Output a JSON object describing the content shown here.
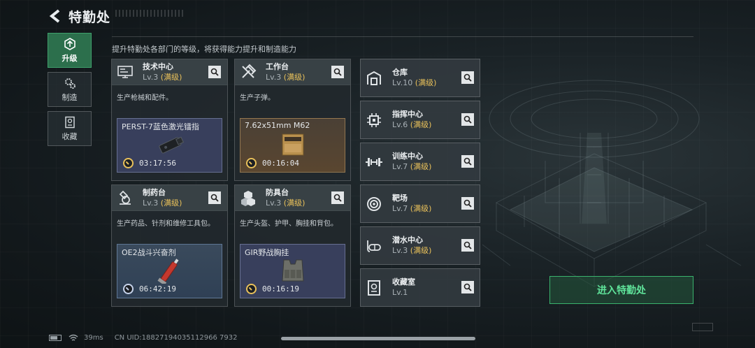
{
  "header": {
    "title": "特勤处"
  },
  "subtitle": "提升特勤处各部门的等级，将获得能力提升和制造能力",
  "nav": [
    {
      "label": "升级",
      "icon": "upgrade-icon",
      "active": true
    },
    {
      "label": "制造",
      "icon": "gears-icon",
      "active": false
    },
    {
      "label": "收藏",
      "icon": "collection-icon",
      "active": false
    }
  ],
  "cards": [
    {
      "name": "技术中心",
      "level": "Lv.3",
      "status": "(满级)",
      "desc": "生产枪械和配件。",
      "icon": "tech-center-icon",
      "craft": {
        "item": "PERST-7蓝色激光镭指",
        "timer": "03:17:56",
        "rarity": "purple"
      }
    },
    {
      "name": "工作台",
      "level": "Lv.3",
      "status": "(满级)",
      "desc": "生产子弹。",
      "icon": "workbench-icon",
      "craft": {
        "item": "7.62x51mm M62",
        "timer": "00:16:04",
        "rarity": "orange"
      }
    },
    {
      "name": "制药台",
      "level": "Lv.3",
      "status": "(满级)",
      "desc": "生产药品、针剂和维修工具包。",
      "icon": "pharmacy-icon",
      "craft": {
        "item": "OE2战斗兴奋剂",
        "timer": "06:42:19",
        "rarity": "blue"
      }
    },
    {
      "name": "防具台",
      "level": "Lv.3",
      "status": "(满级)",
      "desc": "生产头盔、护甲、胸挂和背包。",
      "icon": "armor-bench-icon",
      "craft": {
        "item": "GIR野战胸挂",
        "timer": "00:16:19",
        "rarity": "purple"
      }
    }
  ],
  "facilities": [
    {
      "name": "仓库",
      "level": "Lv.10",
      "status": "(满级)",
      "icon": "warehouse-icon"
    },
    {
      "name": "指挥中心",
      "level": "Lv.6",
      "status": "(满级)",
      "icon": "command-center-icon"
    },
    {
      "name": "训练中心",
      "level": "Lv.7",
      "status": "(满级)",
      "icon": "training-center-icon"
    },
    {
      "name": "靶场",
      "level": "Lv.7",
      "status": "(满级)",
      "icon": "shooting-range-icon"
    },
    {
      "name": "潜水中心",
      "level": "Lv.3",
      "status": "(满级)",
      "icon": "diving-center-icon"
    },
    {
      "name": "收藏室",
      "level": "Lv.1",
      "status": "",
      "icon": "collection-room-icon"
    }
  ],
  "enter_button": "进入特勤处",
  "status": {
    "ping": "39ms",
    "uid": "CN UID:18827194035112966 7932"
  },
  "colors": {
    "accent_green": "#3ab36d",
    "maxed_gold": "#e9c15a"
  }
}
